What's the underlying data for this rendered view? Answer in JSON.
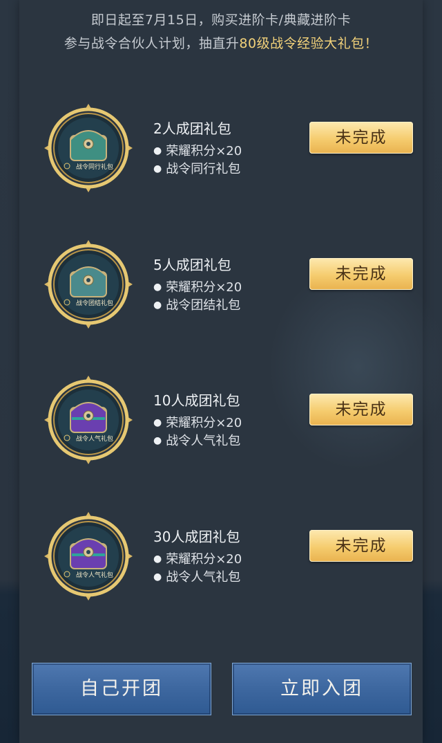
{
  "notice": {
    "line1": "即日起至7月15日，购买进阶卡/典藏进阶卡",
    "line2_prefix": "参与战令合伙人计划，抽直升",
    "line2_highlight": "80级战令经验大礼包",
    "line2_suffix": "！"
  },
  "items": [
    {
      "title": "2人成团礼包",
      "rewards": [
        "荣耀积分×20",
        "战令同行礼包"
      ],
      "medal_label": "战令同行礼包",
      "chest_color": "#3f8f82",
      "status": "未完成"
    },
    {
      "title": "5人成团礼包",
      "rewards": [
        "荣耀积分×20",
        "战令团结礼包"
      ],
      "medal_label": "战令团结礼包",
      "chest_color": "#4a8a8c",
      "status": "未完成"
    },
    {
      "title": "10人成团礼包",
      "rewards": [
        "荣耀积分×20",
        "战令人气礼包"
      ],
      "medal_label": "战令人气礼包",
      "chest_color": "#6a3fb0",
      "status": "未完成"
    },
    {
      "title": "30人成团礼包",
      "rewards": [
        "荣耀积分×20",
        "战令人气礼包"
      ],
      "medal_label": "战令人气礼包",
      "chest_color": "#6a3fb0",
      "status": "未完成"
    }
  ],
  "buttons": {
    "create": "自己开团",
    "join": "立即入团"
  },
  "colors": {
    "highlight": "#f3d27a",
    "status_gold": "#f5cc6e",
    "button_blue": "#3d679f"
  }
}
